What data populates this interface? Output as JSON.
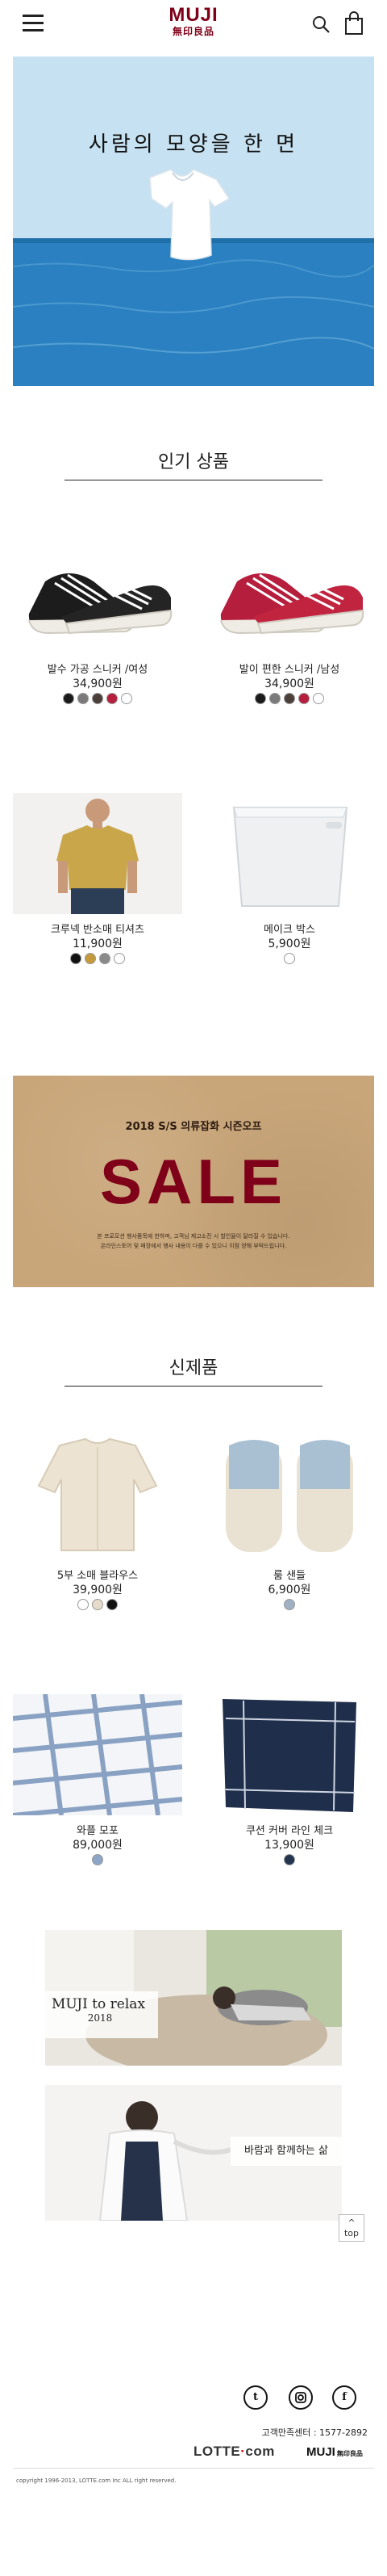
{
  "header": {
    "logo_en": "MUJI",
    "logo_kr": "無印良品",
    "menu_icon": "hamburger-icon",
    "search_icon": "search-icon",
    "cart_icon": "shopping-bag-icon"
  },
  "hero": {
    "title": "사람의 모양을 한 면"
  },
  "popular": {
    "title": "인기 상품",
    "items": [
      {
        "name": "발수 가공 스니커 /여성",
        "price": "34,900원",
        "colors": [
          "#1a1a1a",
          "#7a7a7a",
          "#4a3f39",
          "#b51e3c",
          "#ffffff"
        ]
      },
      {
        "name": "발이 편한 스니커 /남성",
        "price": "34,900원",
        "colors": [
          "#1a1a1a",
          "#7a7a7a",
          "#4a3f39",
          "#b51e3c",
          "#ffffff"
        ]
      },
      {
        "name": "크루넥 반소매 티셔츠",
        "price": "11,900원",
        "colors": [
          "#111111",
          "#c49a3a",
          "#8a8a8a",
          "#ffffff"
        ]
      },
      {
        "name": "메이크 박스",
        "price": "5,900원",
        "colors": [
          "#ffffff"
        ]
      }
    ]
  },
  "sale": {
    "subtitle": "2018 S/S 의류잡화 시즌오프",
    "headline": "SALE",
    "note_1": "본 프로모션 행사품목에 한하며, 고객님 제고소진 시 할인율이 달라질 수 있습니다.",
    "note_2": "온라인스토어 및 매장에서 행사 내용이 다를 수 있으니 이점 양해 부탁드립니다."
  },
  "new": {
    "title": "신제품",
    "items": [
      {
        "name": "5부 소매 블라우스",
        "price": "39,900원",
        "colors": [
          "#ffffff",
          "#e7dccb",
          "#111111"
        ]
      },
      {
        "name": "룸 샌들",
        "price": "6,900원",
        "colors": [
          "#9fb1c3"
        ]
      },
      {
        "name": "와플 모포",
        "price": "89,000원",
        "colors": [
          "#8ea6c6"
        ]
      },
      {
        "name": "쿠션 커버 라인 체크",
        "price": "13,900원",
        "colors": [
          "#23344f"
        ]
      }
    ]
  },
  "promos": {
    "relax_title": "MUJI to relax",
    "relax_year": "2018",
    "breeze_title": "바람과 함께하는 삶"
  },
  "top_button": {
    "arrow": "^",
    "label": "top"
  },
  "footer": {
    "social": [
      "twitter-icon",
      "instagram-icon",
      "facebook-icon"
    ],
    "customer_center": "고객만족센터 : 1577-2892",
    "lotte_logo_a": "LOTTE",
    "lotte_logo_dot": "·",
    "lotte_logo_b": "com",
    "muji_en": "MUJI",
    "muji_kr": "無印良品",
    "copyright": "copyright 1996-2013, LOTTE.com Inc ALL right reserved."
  }
}
